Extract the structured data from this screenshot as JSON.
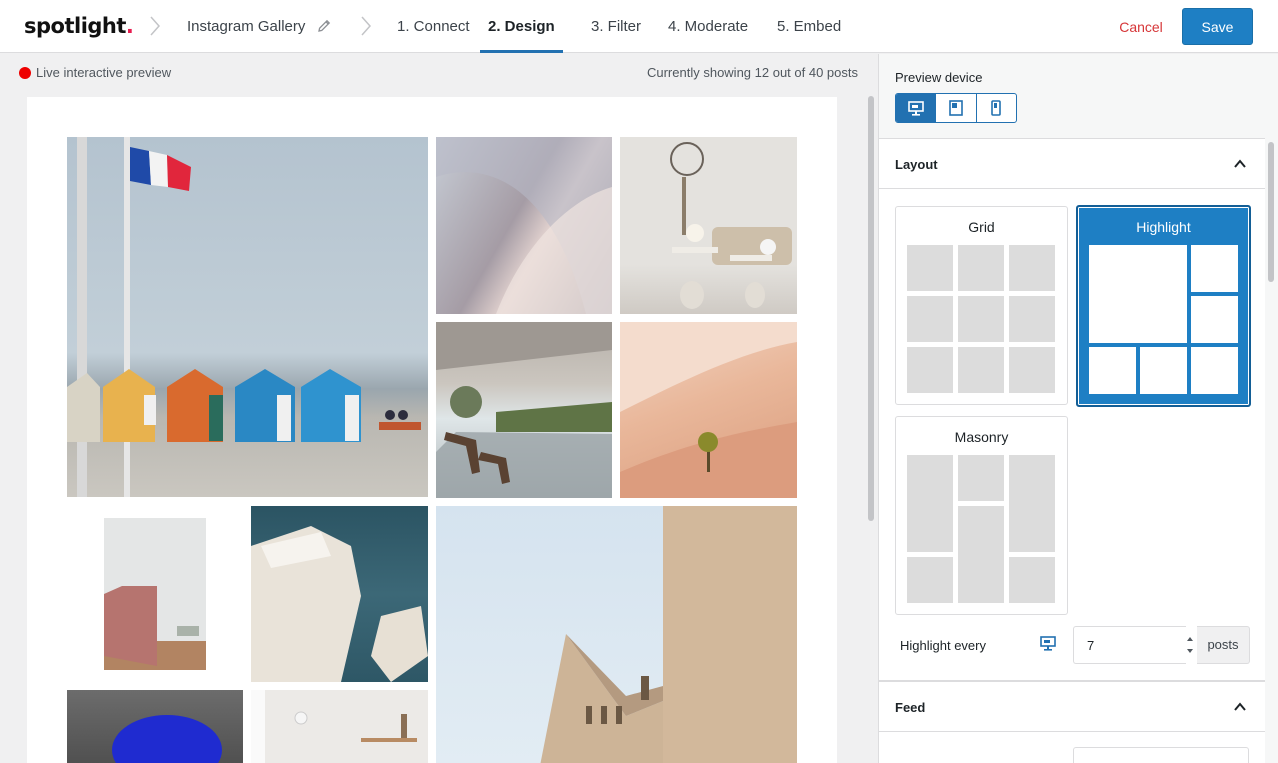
{
  "header": {
    "logo_text": "spotlight",
    "logo_dot": ".",
    "feed_name": "Instagram Gallery",
    "steps": [
      {
        "label": "1. Connect",
        "active": false
      },
      {
        "label": "2. Design",
        "active": true
      },
      {
        "label": "3. Filter",
        "active": false
      },
      {
        "label": "4. Moderate",
        "active": false
      },
      {
        "label": "5. Embed",
        "active": false
      }
    ],
    "cancel_label": "Cancel",
    "save_label": "Save"
  },
  "preview": {
    "live_label": "Live interactive preview",
    "showing_text": "Currently showing 12 out of 40 posts"
  },
  "sidebar": {
    "preview_device_label": "Preview device",
    "devices": [
      "desktop-icon",
      "tablet-icon",
      "phone-icon"
    ],
    "selected_device": "desktop",
    "layout": {
      "title": "Layout",
      "options": [
        "Grid",
        "Highlight",
        "Masonry"
      ],
      "selected": "Highlight"
    },
    "highlight_every": {
      "label": "Highlight every",
      "value": "7",
      "suffix": "posts"
    },
    "feed": {
      "title": "Feed"
    }
  },
  "colors": {
    "accent": "#2271b1",
    "save": "#1e7fc4",
    "cancel": "#d63638",
    "live": "#ee0000"
  }
}
